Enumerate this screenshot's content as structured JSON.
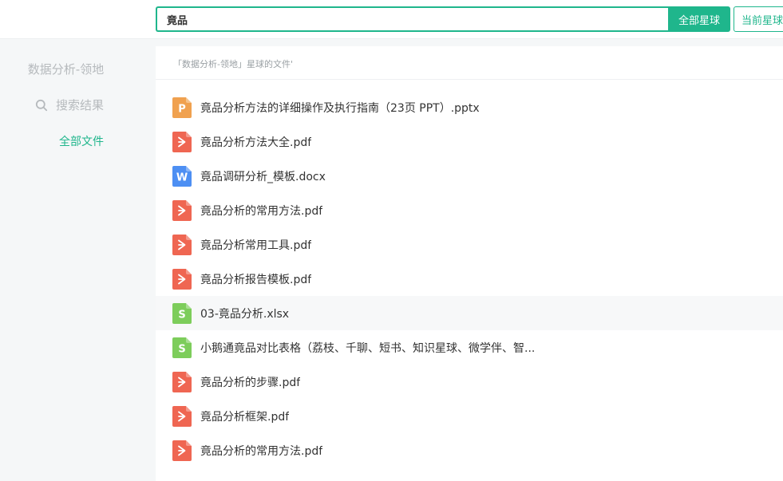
{
  "search": {
    "value": "竟品",
    "all_button": "全部星球",
    "current_button": "当前星球"
  },
  "sidebar": {
    "title": "数据分析-领地",
    "search_results": "搜索结果",
    "all_files": "全部文件"
  },
  "main": {
    "breadcrumb": "「数据分析-领地」星球的文件'",
    "files": [
      {
        "name": "竟品分析方法的详细操作及执行指南（23页 PPT）.pptx",
        "icon": "ppt-file-icon",
        "type": "ppt"
      },
      {
        "name": "竟品分析方法大全.pdf",
        "icon": "pdf-file-icon",
        "type": "pdf"
      },
      {
        "name": "竟品调研分析_模板.docx",
        "icon": "word-file-icon",
        "type": "doc"
      },
      {
        "name": "竟品分析的常用方法.pdf",
        "icon": "pdf-file-icon",
        "type": "pdf"
      },
      {
        "name": "竟品分析常用工具.pdf",
        "icon": "pdf-file-icon",
        "type": "pdf"
      },
      {
        "name": "竟品分析报告模板.pdf",
        "icon": "pdf-file-icon",
        "type": "pdf"
      },
      {
        "name": "03-竟品分析.xlsx",
        "icon": "sheet-file-icon",
        "type": "xls"
      },
      {
        "name": "小鹅通竟品对比表格（荔枝、千聊、短书、知识星球、微学伴、智...",
        "icon": "sheet-file-icon",
        "type": "xls"
      },
      {
        "name": "竟品分析的步骤.pdf",
        "icon": "pdf-file-icon",
        "type": "pdf"
      },
      {
        "name": "竟品分析框架.pdf",
        "icon": "pdf-file-icon",
        "type": "pdf"
      },
      {
        "name": "竟品分析的常用方法.pdf",
        "icon": "pdf-file-icon",
        "type": "pdf"
      }
    ]
  },
  "colors": {
    "accent": "#1fb68c",
    "ppt": "#f0a14f",
    "pdf": "#ef6652",
    "doc": "#4d8ff3",
    "xls": "#7dcd5b"
  }
}
